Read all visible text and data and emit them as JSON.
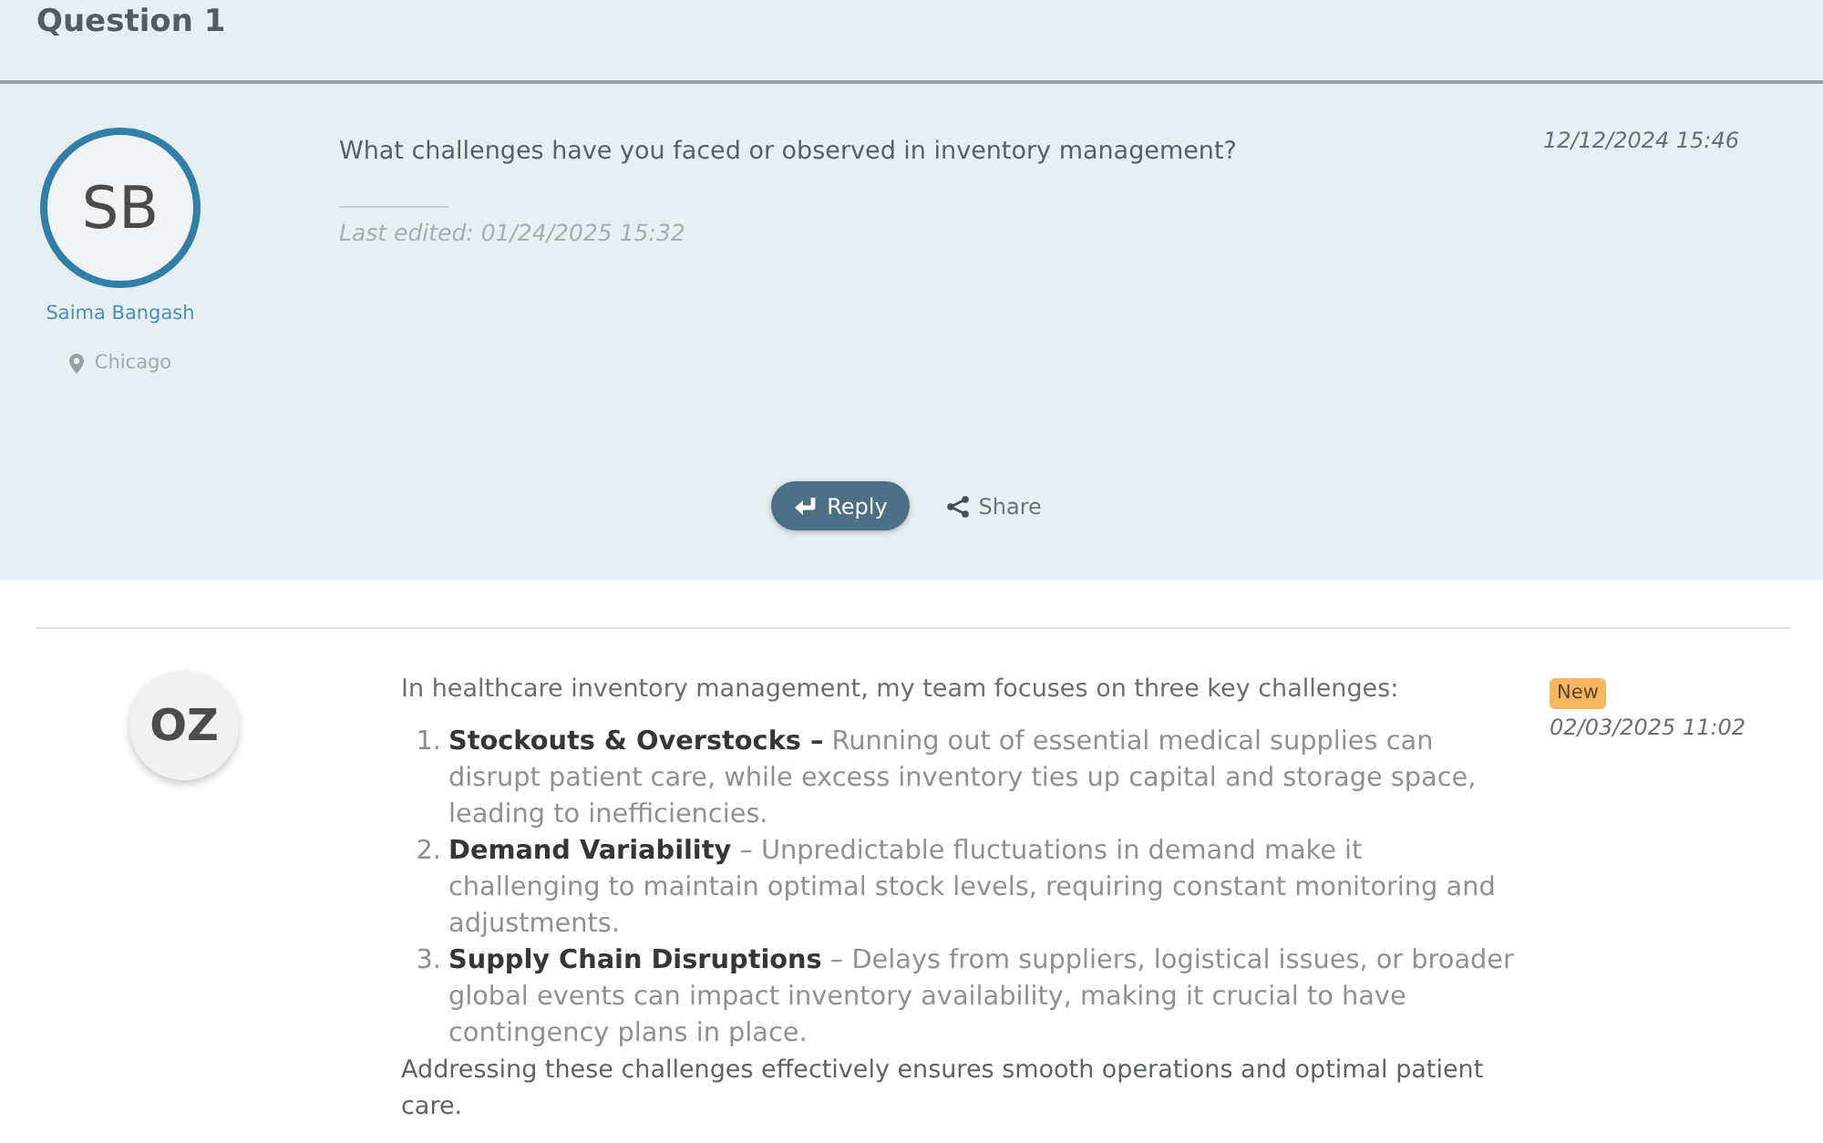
{
  "header": {
    "title": "Question 1"
  },
  "question": {
    "author": {
      "initials": "SB",
      "name": "Saima Bangash",
      "location": "Chicago"
    },
    "text": "What challenges have you faced or observed in inventory management?",
    "edited": "Last edited: 01/24/2025 15:32",
    "timestamp": "12/12/2024 15:46",
    "actions": [
      {
        "kind": "reply",
        "label": "Reply"
      },
      {
        "kind": "share",
        "label": "Share"
      }
    ]
  },
  "answers": [
    {
      "author": {
        "initials": "OZ"
      },
      "badge": "New",
      "timestamp": "02/03/2025 11:02",
      "intro": "In healthcare inventory management, my team focuses on three key challenges:",
      "points": [
        {
          "number": "1.",
          "text": "**Stockouts & Overstocks –** Running out of essential medical supplies can disrupt patient care, while excess inventory ties up capital and storage space, leading to inefficiencies."
        },
        {
          "number": "2.",
          "text": "**Demand Variability** – Unpredictable fluctuations in demand make it challenging to maintain optimal stock levels, requiring constant monitoring and adjustments."
        },
        {
          "number": "3.",
          "text": "**Supply Chain Disruptions** – Delays from suppliers, logistical issues, or broader global events can impact inventory availability, making it crucial to have contingency plans in place."
        }
      ],
      "closing": "Addressing these challenges effectively ensures smooth operations and optimal patient care."
    }
  ]
}
